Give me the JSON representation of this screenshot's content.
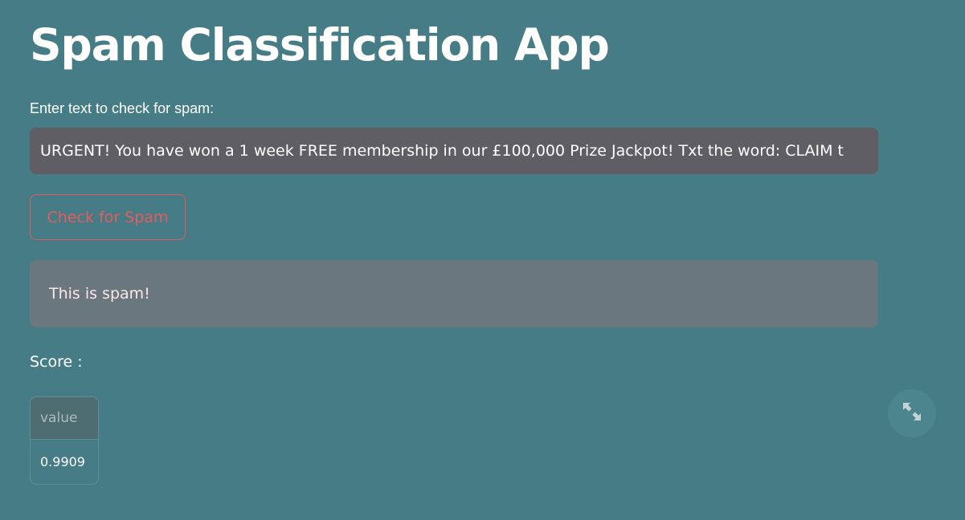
{
  "app": {
    "title": "Spam Classification App"
  },
  "input": {
    "label": "Enter text to check for spam:",
    "value": "URGENT! You have won a 1 week FREE membership in our £100,000 Prize Jackpot! Txt the word: CLAIM t"
  },
  "button": {
    "label": "Check for Spam"
  },
  "result": {
    "message": "This is spam!"
  },
  "score": {
    "label": "Score :",
    "table": {
      "header": "value",
      "value": "0.9909"
    }
  },
  "icons": {
    "expand": "expand-arrows-icon"
  },
  "colors": {
    "background": "#467c85",
    "input_background": "#5e5e64",
    "button_accent": "#e75b5f",
    "result_background": "#6a777f",
    "result_text": "#fde6e8"
  }
}
